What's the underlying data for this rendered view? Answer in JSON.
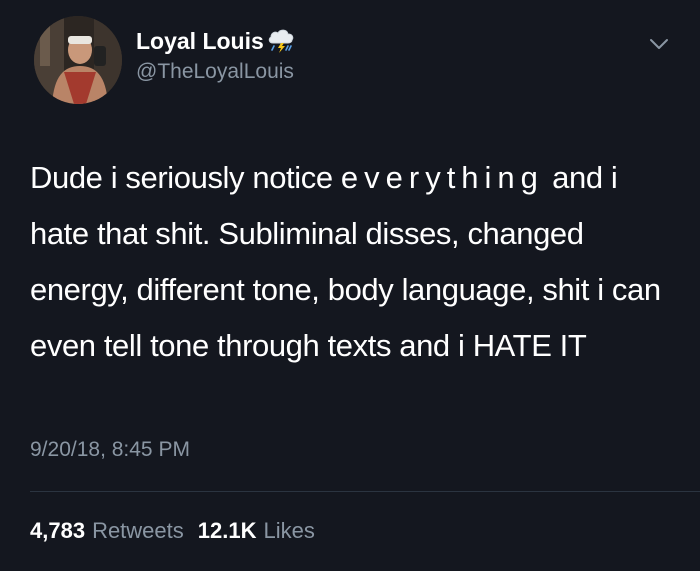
{
  "tweet": {
    "author": {
      "display_name": "Loyal Louis",
      "handle": "@TheLoyalLouis",
      "name_emoji_icon": "cloud-with-lightning-and-rain-icon",
      "avatar_icon": "profile-photo"
    },
    "text": {
      "part_before": "Dude i seriously notice ",
      "spaced_word": "everything",
      "part_after": " and i hate that shit. Subliminal disses, changed energy, different tone, body language, shit i can even tell tone through texts and i HATE IT"
    },
    "timestamp": "9/20/18, 8:45 PM",
    "stats": {
      "retweets_count": "4,783",
      "retweets_label": "Retweets",
      "likes_count": "12.1K",
      "likes_label": "Likes"
    },
    "menu_icon": "chevron-down-icon"
  },
  "colors": {
    "background": "#14171f",
    "primary_text": "#ffffff",
    "secondary_text": "#8a96a3",
    "divider": "#2b3440"
  }
}
